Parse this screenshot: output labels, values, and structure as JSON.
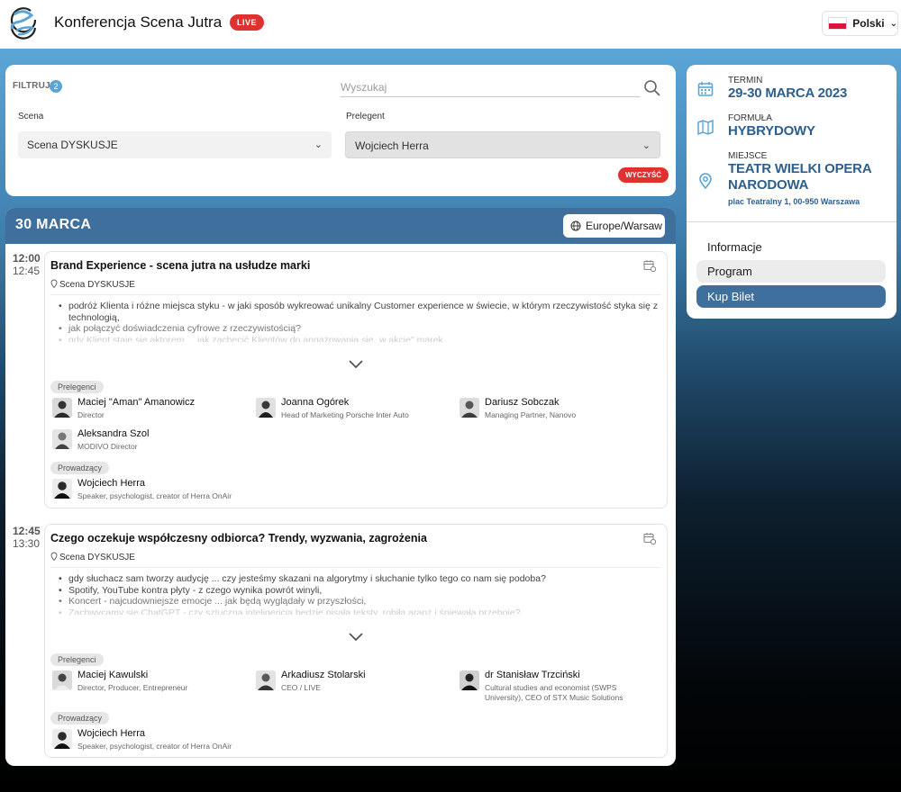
{
  "header": {
    "title": "Konferencja Scena Jutra",
    "live_badge": "LIVE",
    "language": "Polski"
  },
  "filters": {
    "label": "FILTRUJ",
    "count": "2",
    "search_placeholder": "Wyszukaj",
    "stage_label": "Scena",
    "stage_value": "Scena DYSKUSJE",
    "speaker_label": "Prelegent",
    "speaker_value": "Wojciech Herra",
    "clear_label": "WYCZYŚĆ"
  },
  "event_info": {
    "date_caption": "TERMIN",
    "date_value": "29-30 MARCA 2023",
    "format_caption": "FORMUŁA",
    "format_value": "HYBRYDOWY",
    "venue_caption": "MIEJSCE",
    "venue_line1": "TEATR WIELKI OPERA",
    "venue_line2": "NARODOWA",
    "venue_address": "plac Teatralny 1, 00-950 Warszawa",
    "nav": [
      "Informacje",
      "Program",
      "Kup Bilet"
    ]
  },
  "program": {
    "day_title": "30 MARCA",
    "timezone": "Europe/Warsaw",
    "sessions": [
      {
        "start": "12:00",
        "end": "12:45",
        "title": "Brand Experience - scena jutra na usłudze marki",
        "stage": "Scena DYSKUSJE",
        "description": [
          "podróż Klienta i różne miejsca styku - w jaki sposób wykreować unikalny Customer experience w świecie, w którym rzeczywistość styka się z technologią,",
          "jak połączyć doświadczenia cyfrowe z rzeczywistością?",
          "gdy Klient staje się aktorem ... jak zachęcić Klientów do angażowania się „w akcję\" marek,"
        ],
        "speakers_label": "Prelegenci",
        "speakers": [
          {
            "name": "Maciej \"Aman\" Amanowicz",
            "role": "Director"
          },
          {
            "name": "Joanna Ogórek",
            "role": "Head of Marketing Porsche Inter Auto"
          },
          {
            "name": "Dariusz Sobczak",
            "role": "Managing Partner, Nanovo"
          },
          {
            "name": "Aleksandra Szol",
            "role": "MODIVO Director"
          }
        ],
        "hosts_label": "Prowadzący",
        "hosts": [
          {
            "name": "Wojciech Herra",
            "role": "Speaker, psychologist, creator of Herra OnAir"
          }
        ]
      },
      {
        "start": "12:45",
        "end": "13:30",
        "title": "Czego oczekuje współczesny odbiorca? Trendy, wyzwania, zagrożenia",
        "stage": "Scena DYSKUSJE",
        "description": [
          "gdy słuchacz sam tworzy audycję ... czy jesteśmy skazani na algorytmy i słuchanie tylko tego co nam się podoba?",
          "Spotify, YouTube kontra płyty - z czego wynika powrót winyli,",
          "Koncert - najcudowniejsze emocje ... jak będą wyglądały w przyszłości,",
          "Zachwycamy się ChatGPT - czy sztuczna inteligencja będzie pisała teksty, robiła aranż i śpiewała przeboje?"
        ],
        "speakers_label": "Prelegenci",
        "speakers": [
          {
            "name": "Maciej Kawulski",
            "role": "Director, Producer, Entrepreneur"
          },
          {
            "name": "Arkadiusz Stolarski",
            "role": "CEO / LIVE"
          },
          {
            "name": "dr Stanisław Trzciński",
            "role": "Cultural studies and economist (SWPS University), CEO of STX Music Solutions"
          }
        ],
        "hosts_label": "Prowadzący",
        "hosts": [
          {
            "name": "Wojciech Herra",
            "role": "Speaker, psychologist, creator of Herra OnAir"
          }
        ]
      }
    ]
  },
  "colors": {
    "accent_blue": "#2d5f8e",
    "day_header": "#3f6f9c",
    "live_red": "#e03131",
    "buy_ticket": "#3f6f9c"
  }
}
